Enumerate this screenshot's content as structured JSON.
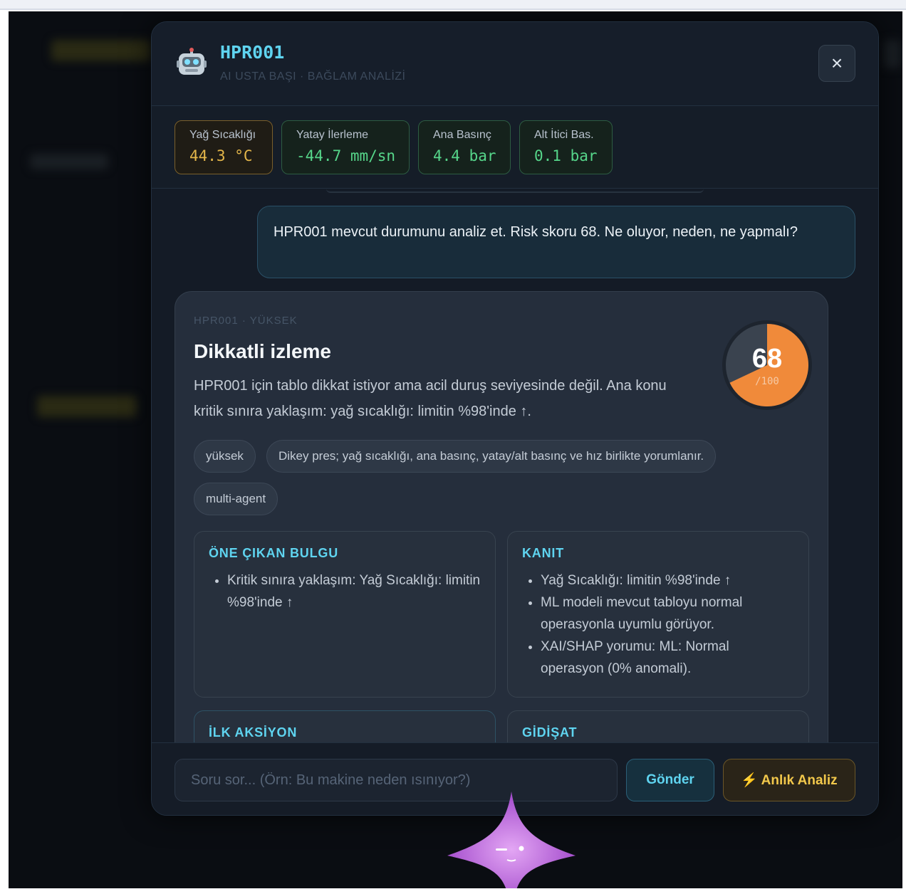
{
  "modal": {
    "title": "HPR001",
    "subtitle": "AI USTA BAŞI · BAĞLAM ANALİZİ",
    "close_label": "×",
    "robot_icon": "robot-icon"
  },
  "metrics": [
    {
      "label": "Yağ Sıcaklığı",
      "value": "44.3 °C",
      "color": "#e3b64a",
      "border": "#7a5f2a"
    },
    {
      "label": "Yatay İlerleme",
      "value": "-44.7 mm/sn",
      "color": "#56d68a",
      "border": "#2d5c42"
    },
    {
      "label": "Ana Basınç",
      "value": "4.4 bar",
      "color": "#56d68a",
      "border": "#2d5c42"
    },
    {
      "label": "Alt İtici Bas.",
      "value": "0.1 bar",
      "color": "#56d68a",
      "border": "#2d5c42"
    }
  ],
  "chat": {
    "user_message": "HPR001 mevcut durumunu analiz et. Risk skoru 68. Ne oluyor, neden, ne yapmalı?",
    "ai": {
      "meta": "HPR001 · YÜKSEK",
      "title": "Dikkatli izleme",
      "body": "HPR001 için tablo dikkat istiyor ama acil duruş seviyesinde değil. Ana konu kritik sınıra yaklaşım: yağ sıcaklığı: limitin %98'inde ↑.",
      "score": 68,
      "score_max": "/100",
      "score_color": "#f08a3a",
      "tags": [
        "yüksek",
        "Dikey pres; yağ sıcaklığı, ana basınç, yatay/alt basınç ve hız birlikte yorumlanır.",
        "multi-agent"
      ],
      "panels": {
        "highlight": {
          "title": "ÖNE ÇIKAN BULGU",
          "items": [
            "Kritik sınıra yaklaşım: Yağ Sıcaklığı: limitin %98'inde ↑"
          ]
        },
        "evidence": {
          "title": "KANIT",
          "items": [
            "Yağ Sıcaklığı: limitin %98'inde ↑",
            "ML modeli mevcut tabloyu normal operasyonla uyumlu görüyor.",
            "XAI/SHAP yorumu: ML: Normal operasyon (0% anomali)."
          ]
        },
        "first_action": {
          "title": "İLK AKSİYON"
        },
        "trend": {
          "title": "GİDİŞAT"
        }
      }
    }
  },
  "footer": {
    "input_placeholder": "Soru sor... (Örn: Bu makine neden ısınıyor?)",
    "send_label": "Gönder",
    "analyze_label": "⚡ Anlık Analiz"
  }
}
